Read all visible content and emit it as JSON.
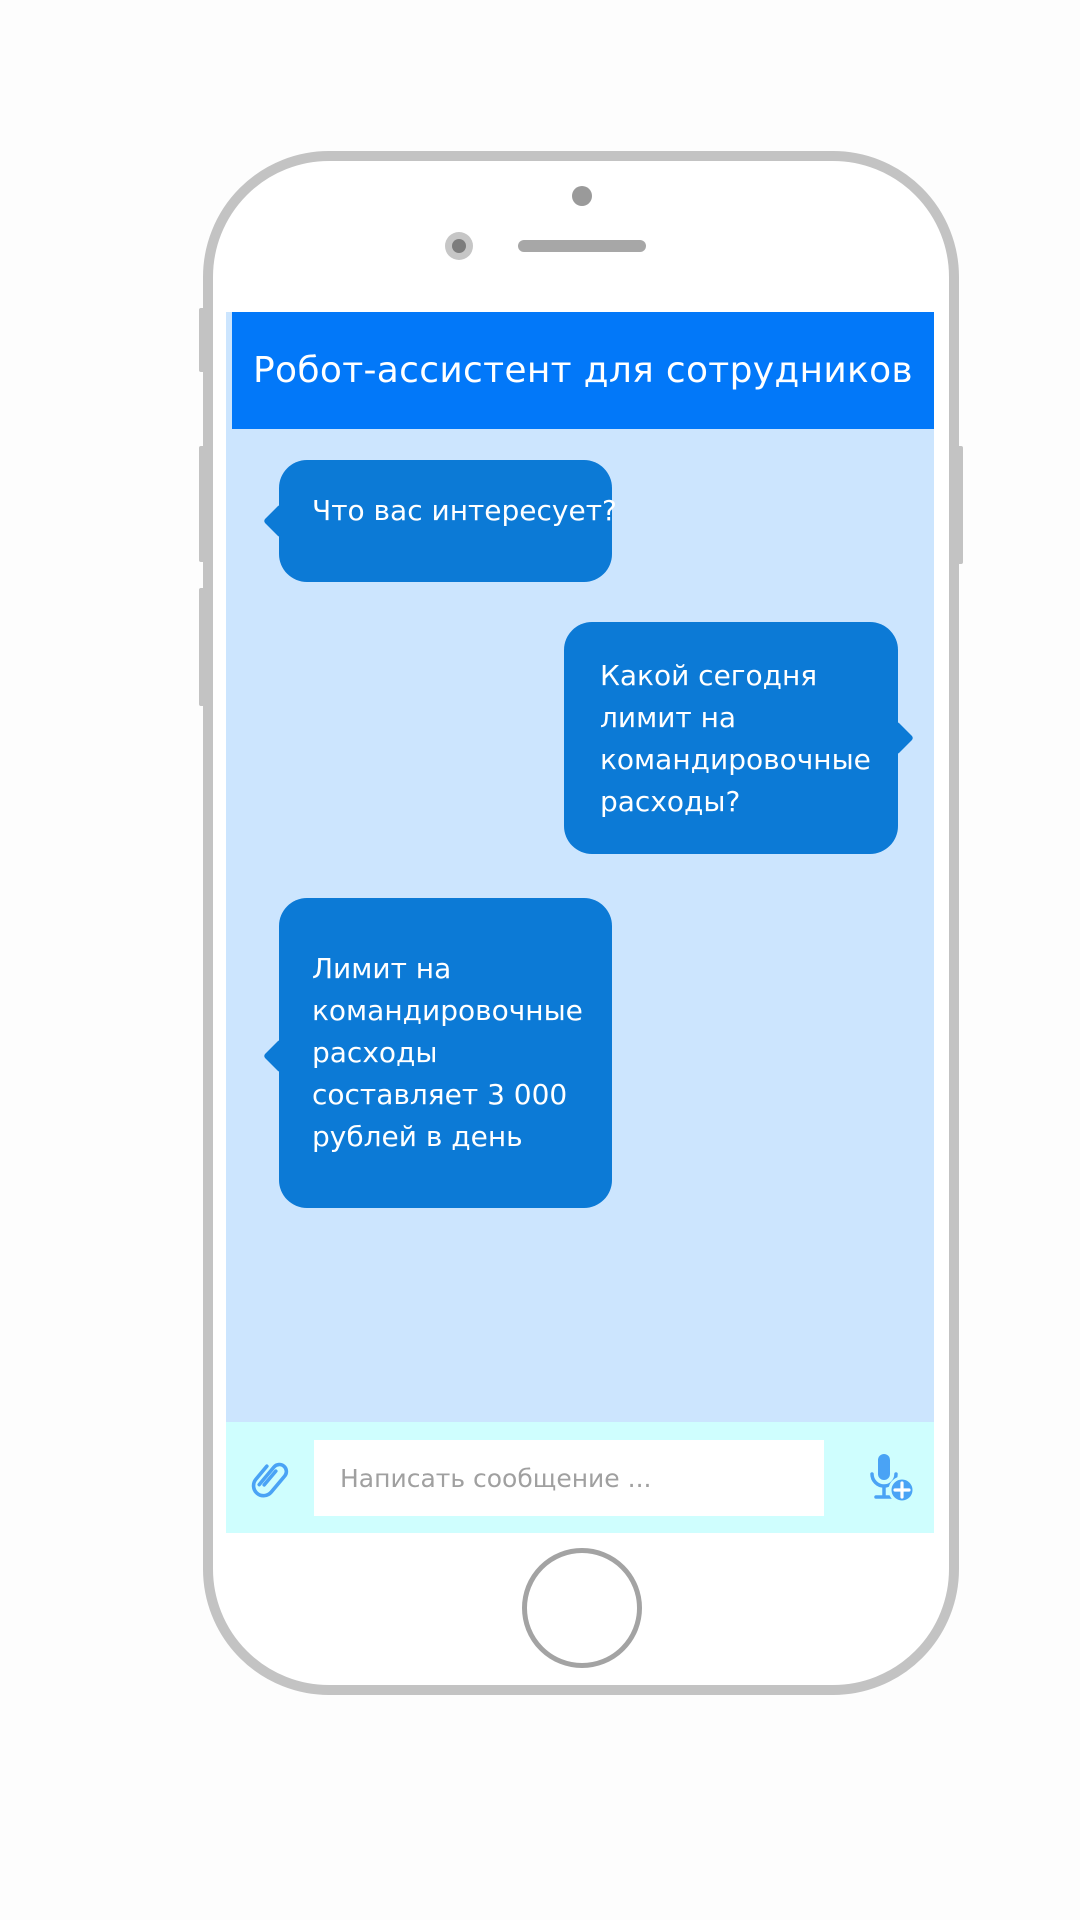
{
  "app": {
    "title": "Робот-ассистент для сотрудников"
  },
  "messages": [
    {
      "sender": "bot",
      "text": "Что вас интересует?"
    },
    {
      "sender": "user",
      "text": "Какой сегодня лимит на командировочные расходы?"
    },
    {
      "sender": "bot",
      "text": "Лимит на командировочные расходы составляет 3 000 рублей в день"
    }
  ],
  "composer": {
    "placeholder": "Написать сообщение ...",
    "value": "",
    "attach_icon": "paperclip-icon",
    "voice_icon": "microphone-add-icon"
  },
  "colors": {
    "header": "#0278f9",
    "chat_background": "#cce5fe",
    "bubble": "#0c7ad6",
    "composer_background": "#cffefe",
    "icon_accent": "#4aa3f5"
  }
}
